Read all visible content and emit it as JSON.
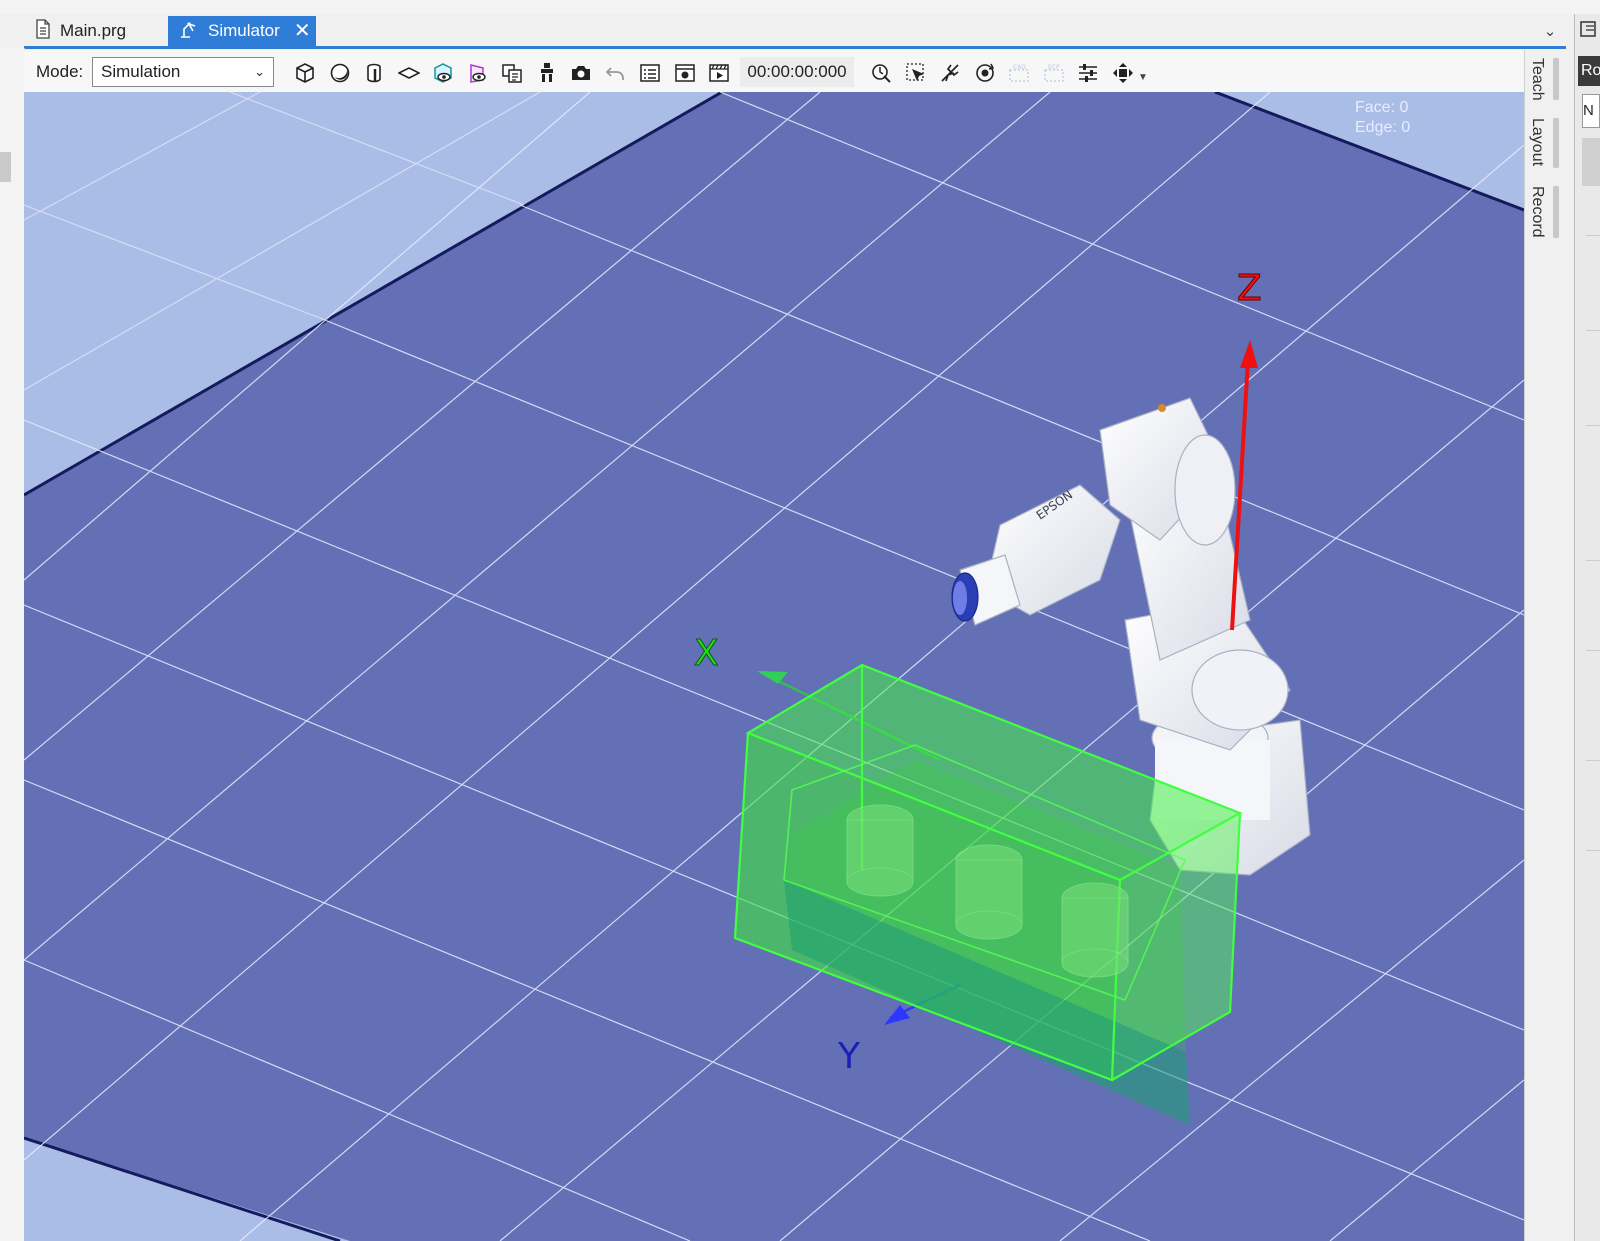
{
  "tabs": [
    {
      "label": "Main.prg",
      "icon": "document-icon",
      "active": false
    },
    {
      "label": "Simulator",
      "icon": "robot-tab-icon",
      "active": true
    }
  ],
  "toolbar": {
    "mode_label": "Mode:",
    "mode_value": "Simulation",
    "timecode": "00:00:00:000",
    "icons_left": [
      "box-icon",
      "sphere-icon",
      "cylinder-icon",
      "plane-icon",
      "view-cube-icon",
      "view-object-icon",
      "layers-icon",
      "gripper-icon",
      "camera-icon",
      "undo-icon",
      "list-icon",
      "snapshot-icon",
      "video-icon"
    ],
    "icons_right": [
      "clock-robot-icon",
      "select-object-icon",
      "measure-icon",
      "rotate-icon",
      "cad-icon",
      "ecp-icon",
      "sliders-icon",
      "move-icon"
    ]
  },
  "viewport": {
    "face_label": "Face: 0",
    "edge_label": "Edge: 0",
    "axis_x": "X",
    "axis_y": "Y",
    "axis_z": "Z",
    "robot_brand": "EPSON"
  },
  "side_tabs": [
    "Teach",
    "Layout",
    "Record"
  ],
  "right_panel": {
    "title": "Ro",
    "box_text": "N"
  },
  "colors": {
    "accent": "#2f7dd6",
    "floor": "#6370b6",
    "floor_outside": "#a9bde6",
    "collision_box": "#33ee33"
  }
}
